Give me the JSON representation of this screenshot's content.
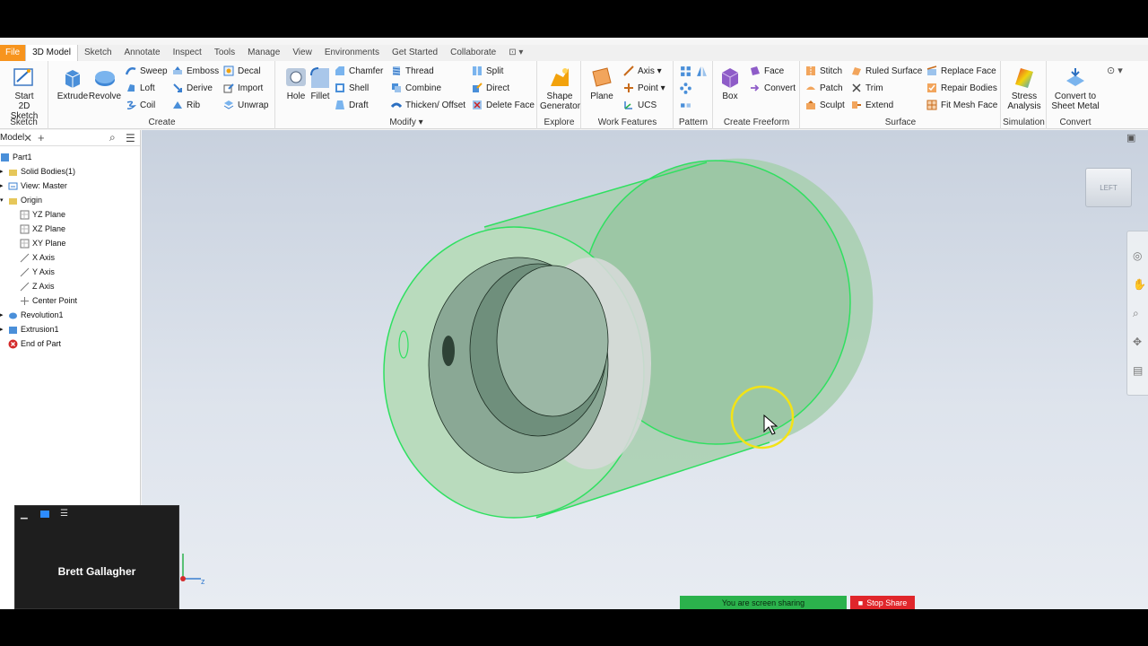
{
  "tabs": [
    "File",
    "3D Model",
    "Sketch",
    "Annotate",
    "Inspect",
    "Tools",
    "Manage",
    "View",
    "Environments",
    "Get Started",
    "Collaborate"
  ],
  "ribbon": {
    "sketch": {
      "start_sketch": "Start\n2D Sketch",
      "title": "Sketch"
    },
    "create": {
      "extrude": "Extrude",
      "revolve": "Revolve",
      "sweep": "Sweep",
      "loft": "Loft",
      "coil": "Coil",
      "emboss": "Emboss",
      "derive": "Derive",
      "rib": "Rib",
      "decal": "Decal",
      "import": "Import",
      "unwrap": "Unwrap",
      "title": "Create"
    },
    "modify": {
      "hole": "Hole",
      "fillet": "Fillet",
      "chamfer": "Chamfer",
      "shell": "Shell",
      "draft": "Draft",
      "thread": "Thread",
      "combine": "Combine",
      "thicken": "Thicken/ Offset",
      "split": "Split",
      "direct": "Direct",
      "delete_face": "Delete Face",
      "title": "Modify"
    },
    "explore": {
      "shape_generator": "Shape\nGenerator",
      "title": "Explore"
    },
    "work_features": {
      "plane": "Plane",
      "axis": "Axis",
      "point": "Point",
      "ucs": "UCS",
      "title": "Work Features"
    },
    "pattern": {
      "title": "Pattern"
    },
    "freeform": {
      "box": "Box",
      "face": "Face",
      "convert": "Convert",
      "title": "Create Freeform"
    },
    "surface": {
      "stitch": "Stitch",
      "patch": "Patch",
      "sculpt": "Sculpt",
      "ruled_surface": "Ruled Surface",
      "trim": "Trim",
      "extend": "Extend",
      "replace_face": "Replace Face",
      "repair_bodies": "Repair Bodies",
      "fit_mesh_face": "Fit Mesh Face",
      "title": "Surface"
    },
    "simulation": {
      "stress": "Stress\nAnalysis",
      "title": "Simulation"
    },
    "convert": {
      "sheet_metal": "Convert to\nSheet Metal",
      "title": "Convert"
    }
  },
  "browser": {
    "tab_label": "Model",
    "items": [
      "Part1",
      "Solid Bodies(1)",
      "View: Master",
      "Origin",
      "YZ Plane",
      "XZ Plane",
      "XY Plane",
      "X Axis",
      "Y Axis",
      "Z Axis",
      "Center Point",
      "Revolution1",
      "Extrusion1",
      "End of Part"
    ]
  },
  "viewcube_label": "LEFT",
  "zoom": {
    "participant": "Brett Gallagher",
    "sharing": "You are screen sharing",
    "stop": "Stop Share"
  }
}
